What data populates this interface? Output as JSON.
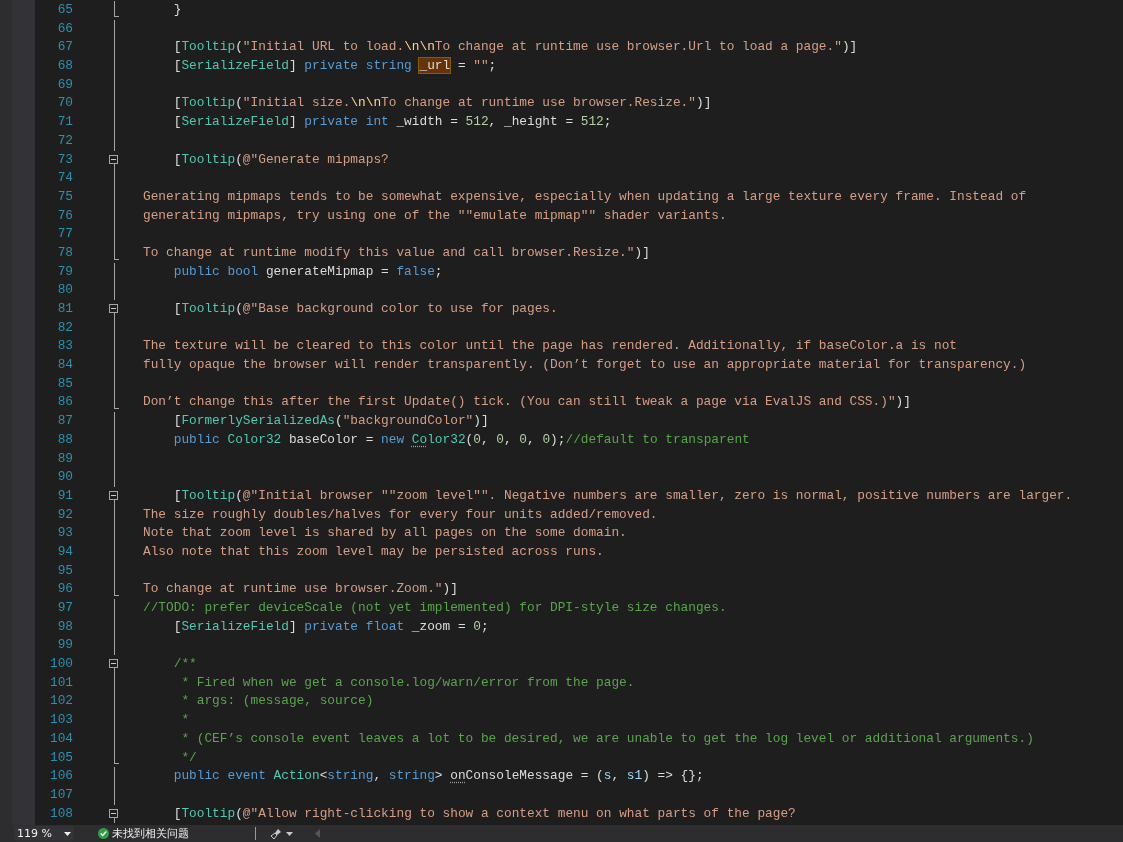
{
  "editor": {
    "lines": [
      {
        "number": "65",
        "kind": "fold_end",
        "segments": [
          {
            "kind": "plain",
            "text": "    }"
          }
        ]
      },
      {
        "number": "66",
        "kind": "code"
      },
      {
        "number": "67",
        "kind": "code",
        "segments": [
          {
            "kind": "plain",
            "text": "    ["
          },
          {
            "kind": "type",
            "text": "Tooltip"
          },
          {
            "kind": "plain",
            "text": "("
          },
          {
            "kind": "string",
            "text": "\"Initial URL to load."
          },
          {
            "kind": "escape",
            "text": "\\n\\n"
          },
          {
            "kind": "string",
            "text": "To change at runtime use browser.Url to load a page.\""
          },
          {
            "kind": "plain",
            "text": ")]"
          }
        ]
      },
      {
        "number": "68",
        "kind": "code",
        "segments": [
          {
            "kind": "plain",
            "text": "    ["
          },
          {
            "kind": "type",
            "text": "SerializeField"
          },
          {
            "kind": "plain",
            "text": "] "
          },
          {
            "kind": "keyword",
            "text": "private "
          },
          {
            "kind": "keyword",
            "text": "string "
          },
          {
            "kind": "highlight",
            "text": "_url"
          },
          {
            "kind": "plain",
            "text": " = "
          },
          {
            "kind": "string",
            "text": "\"\""
          },
          {
            "kind": "plain",
            "text": ";"
          }
        ]
      },
      {
        "number": "69",
        "kind": "code"
      },
      {
        "number": "70",
        "kind": "code",
        "segments": [
          {
            "kind": "plain",
            "text": "    ["
          },
          {
            "kind": "type",
            "text": "Tooltip"
          },
          {
            "kind": "plain",
            "text": "("
          },
          {
            "kind": "string",
            "text": "\"Initial size."
          },
          {
            "kind": "escape",
            "text": "\\n\\n"
          },
          {
            "kind": "string",
            "text": "To change at runtime use browser.Resize.\""
          },
          {
            "kind": "plain",
            "text": ")]"
          }
        ]
      },
      {
        "number": "71",
        "kind": "code",
        "segments": [
          {
            "kind": "plain",
            "text": "    ["
          },
          {
            "kind": "type",
            "text": "SerializeField"
          },
          {
            "kind": "plain",
            "text": "] "
          },
          {
            "kind": "keyword",
            "text": "private "
          },
          {
            "kind": "keyword",
            "text": "int"
          },
          {
            "kind": "plain",
            "text": " _width = "
          },
          {
            "kind": "number",
            "text": "512"
          },
          {
            "kind": "plain",
            "text": ", _height = "
          },
          {
            "kind": "number",
            "text": "512"
          },
          {
            "kind": "plain",
            "text": ";"
          }
        ]
      },
      {
        "number": "72",
        "kind": "code"
      },
      {
        "number": "73",
        "kind": "fold_start",
        "expanded": true,
        "segments": [
          {
            "kind": "plain",
            "text": "    ["
          },
          {
            "kind": "type",
            "text": "Tooltip"
          },
          {
            "kind": "plain",
            "text": "("
          },
          {
            "kind": "string",
            "text": "@\"Generate mipmaps?"
          }
        ]
      },
      {
        "number": "74",
        "kind": "code"
      },
      {
        "number": "75",
        "kind": "code",
        "segments": [
          {
            "kind": "string",
            "text": "Generating mipmaps tends to be somewhat expensive, especially when updating a large texture every frame. Instead of"
          }
        ]
      },
      {
        "number": "76",
        "kind": "code",
        "segments": [
          {
            "kind": "string",
            "text": "generating mipmaps, try using one of the \"\"emulate mipmap\"\" shader variants."
          }
        ]
      },
      {
        "number": "77",
        "kind": "code"
      },
      {
        "number": "78",
        "kind": "fold_end",
        "segments": [
          {
            "kind": "string",
            "text": "To change at runtime modify this value and call browser.Resize.\""
          },
          {
            "kind": "plain",
            "text": ")]"
          }
        ]
      },
      {
        "number": "79",
        "kind": "code",
        "segments": [
          {
            "kind": "keyword",
            "text": "    public bool"
          },
          {
            "kind": "plain",
            "text": " generateMipmap = "
          },
          {
            "kind": "keyword",
            "text": "false"
          },
          {
            "kind": "plain",
            "text": ";"
          }
        ]
      },
      {
        "number": "80",
        "kind": "code"
      },
      {
        "number": "81",
        "kind": "fold_start",
        "expanded": true,
        "segments": [
          {
            "kind": "plain",
            "text": "    ["
          },
          {
            "kind": "type",
            "text": "Tooltip"
          },
          {
            "kind": "plain",
            "text": "("
          },
          {
            "kind": "string",
            "text": "@\"Base background color to use for pages."
          }
        ]
      },
      {
        "number": "82",
        "kind": "code"
      },
      {
        "number": "83",
        "kind": "code",
        "segments": [
          {
            "kind": "string",
            "text": "The texture will be cleared to this color until the page has rendered. Additionally, if baseColor.a is not"
          }
        ]
      },
      {
        "number": "84",
        "kind": "code",
        "segments": [
          {
            "kind": "string",
            "text": "fully opaque the browser will render transparently. (Don’t forget to use an appropriate material for transparency.)"
          }
        ]
      },
      {
        "number": "85",
        "kind": "code"
      },
      {
        "number": "86",
        "kind": "fold_end",
        "segments": [
          {
            "kind": "string",
            "text": "Don’t change this after the first Update() tick. (You can still tweak a page via EvalJS and CSS.)\""
          },
          {
            "kind": "plain",
            "text": ")]"
          }
        ]
      },
      {
        "number": "87",
        "kind": "code",
        "segments": [
          {
            "kind": "plain",
            "text": "    ["
          },
          {
            "kind": "type",
            "text": "FormerlySerializedAs"
          },
          {
            "kind": "plain",
            "text": "("
          },
          {
            "kind": "string",
            "text": "\"backgroundColor\""
          },
          {
            "kind": "plain",
            "text": ")]"
          }
        ]
      },
      {
        "number": "88",
        "kind": "code",
        "segments": [
          {
            "kind": "keyword",
            "text": "    public "
          },
          {
            "kind": "type",
            "text": "Color32"
          },
          {
            "kind": "plain",
            "text": " baseColor = "
          },
          {
            "kind": "keyword",
            "text": "new "
          },
          {
            "kind": "type",
            "text": "Co",
            "hint": true
          },
          {
            "kind": "type",
            "text": "lor32"
          },
          {
            "kind": "plain",
            "text": "("
          },
          {
            "kind": "number",
            "text": "0"
          },
          {
            "kind": "plain",
            "text": ", "
          },
          {
            "kind": "number",
            "text": "0"
          },
          {
            "kind": "plain",
            "text": ", "
          },
          {
            "kind": "number",
            "text": "0"
          },
          {
            "kind": "plain",
            "text": ", "
          },
          {
            "kind": "number",
            "text": "0"
          },
          {
            "kind": "plain",
            "text": ");"
          },
          {
            "kind": "comment",
            "text": "//default to transparent"
          }
        ]
      },
      {
        "number": "89",
        "kind": "code"
      },
      {
        "number": "90",
        "kind": "code"
      },
      {
        "number": "91",
        "kind": "fold_start",
        "expanded": true,
        "segments": [
          {
            "kind": "plain",
            "text": "    ["
          },
          {
            "kind": "type",
            "text": "Tooltip"
          },
          {
            "kind": "plain",
            "text": "("
          },
          {
            "kind": "string",
            "text": "@\"Initial browser \"\"zoom level\"\". Negative numbers are smaller, zero is normal, positive numbers are larger."
          }
        ]
      },
      {
        "number": "92",
        "kind": "code",
        "segments": [
          {
            "kind": "string",
            "text": "The size roughly doubles/halves for every four units added/removed."
          }
        ]
      },
      {
        "number": "93",
        "kind": "code",
        "segments": [
          {
            "kind": "string",
            "text": "Note that zoom level is shared by all pages on the some domain."
          }
        ]
      },
      {
        "number": "94",
        "kind": "code",
        "segments": [
          {
            "kind": "string",
            "text": "Also note that this zoom level may be persisted across runs."
          }
        ]
      },
      {
        "number": "95",
        "kind": "code"
      },
      {
        "number": "96",
        "kind": "fold_end",
        "segments": [
          {
            "kind": "string",
            "text": "To change at runtime use browser.Zoom.\""
          },
          {
            "kind": "plain",
            "text": ")]"
          }
        ]
      },
      {
        "number": "97",
        "kind": "code",
        "segments": [
          {
            "kind": "comment",
            "text": "//TODO: prefer deviceScale (not yet implemented) for DPI-style size changes."
          }
        ]
      },
      {
        "number": "98",
        "kind": "code",
        "segments": [
          {
            "kind": "plain",
            "text": "    ["
          },
          {
            "kind": "type",
            "text": "SerializeField"
          },
          {
            "kind": "plain",
            "text": "] "
          },
          {
            "kind": "keyword",
            "text": "private float"
          },
          {
            "kind": "plain",
            "text": " _zoom = "
          },
          {
            "kind": "number",
            "text": "0"
          },
          {
            "kind": "plain",
            "text": ";"
          }
        ]
      },
      {
        "number": "99",
        "kind": "code"
      },
      {
        "number": "100",
        "kind": "fold_start",
        "expanded": true,
        "segments": [
          {
            "kind": "comment",
            "text": "    /**"
          }
        ]
      },
      {
        "number": "101",
        "kind": "code",
        "segments": [
          {
            "kind": "comment",
            "text": "     * Fired when we get a console.log/warn/error from the page."
          }
        ]
      },
      {
        "number": "102",
        "kind": "code",
        "segments": [
          {
            "kind": "comment",
            "text": "     * args: (message, source)"
          }
        ]
      },
      {
        "number": "103",
        "kind": "code",
        "segments": [
          {
            "kind": "comment",
            "text": "     *"
          }
        ]
      },
      {
        "number": "104",
        "kind": "code",
        "segments": [
          {
            "kind": "comment",
            "text": "     * (CEF’s console event leaves a lot to be desired, we are unable to get the log level or additional arguments.)"
          }
        ]
      },
      {
        "number": "105",
        "kind": "fold_end",
        "segments": [
          {
            "kind": "comment",
            "text": "     */"
          }
        ]
      },
      {
        "number": "106",
        "kind": "code",
        "segments": [
          {
            "kind": "keyword",
            "text": "    public event "
          },
          {
            "kind": "type",
            "text": "Action"
          },
          {
            "kind": "plain",
            "text": "<"
          },
          {
            "kind": "keyword",
            "text": "string"
          },
          {
            "kind": "plain",
            "text": ", "
          },
          {
            "kind": "keyword",
            "text": "string"
          },
          {
            "kind": "plain",
            "text": "> "
          },
          {
            "kind": "plain",
            "text": "on",
            "hint": true
          },
          {
            "kind": "plain",
            "text": "ConsoleMessage = ("
          },
          {
            "kind": "param",
            "text": "s"
          },
          {
            "kind": "plain",
            "text": ", "
          },
          {
            "kind": "param",
            "text": "s1"
          },
          {
            "kind": "plain",
            "text": ") => {};"
          }
        ]
      },
      {
        "number": "107",
        "kind": "code"
      },
      {
        "number": "108",
        "kind": "fold_start",
        "expanded": true,
        "segments": [
          {
            "kind": "plain",
            "text": "    ["
          },
          {
            "kind": "type",
            "text": "Tooltip"
          },
          {
            "kind": "plain",
            "text": "("
          },
          {
            "kind": "string",
            "text": "@\"Allow right-clicking to show a context menu on what parts of the page?"
          }
        ]
      }
    ]
  },
  "status_bar": {
    "zoom": "119 %",
    "issues": "未找到相关问题"
  }
}
